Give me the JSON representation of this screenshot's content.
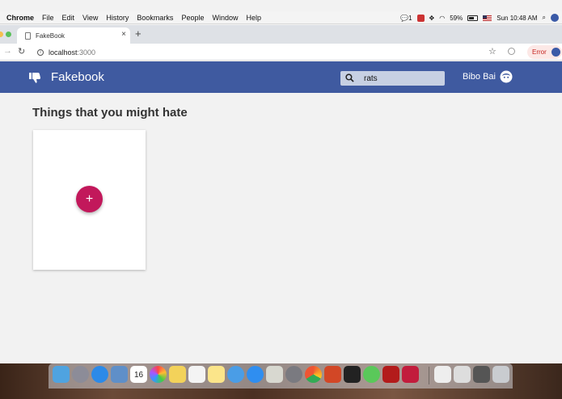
{
  "menubar": {
    "app": "Chrome",
    "menus": [
      "File",
      "Edit",
      "View",
      "History",
      "Bookmarks",
      "People",
      "Window",
      "Help"
    ],
    "wechat_badge": "1",
    "battery": "59%",
    "clock": "Sun 10:48 AM"
  },
  "browser": {
    "tab_title": "FakeBook",
    "close_glyph": "×",
    "new_tab_glyph": "+",
    "url_host": "localhost",
    "url_port": ":3000",
    "error_label": "Error"
  },
  "app": {
    "brand": "Fakebook",
    "search_value": "rats",
    "username": "Bibo Bai",
    "accent_color": "#3f5aa0",
    "fab_color": "#c2185b"
  },
  "content": {
    "section_title": "Things that you might hate",
    "add_glyph": "+"
  },
  "dock": {
    "calendar_day": "16",
    "icons": [
      "finder-icon",
      "launchpad-icon",
      "safari-icon",
      "preview-icon",
      "calendar-icon",
      "photos-icon",
      "stickies-icon",
      "reminders-icon",
      "notes-icon",
      "messages-icon",
      "app-store-icon",
      "script-editor-icon",
      "system-preferences-icon",
      "chrome-icon",
      "powerpoint-icon",
      "terminal-icon",
      "wechat-icon",
      "acrobat-icon",
      "rubymine-icon",
      "document-icon",
      "folder-icon",
      "downloads-icon",
      "trash-icon"
    ]
  }
}
